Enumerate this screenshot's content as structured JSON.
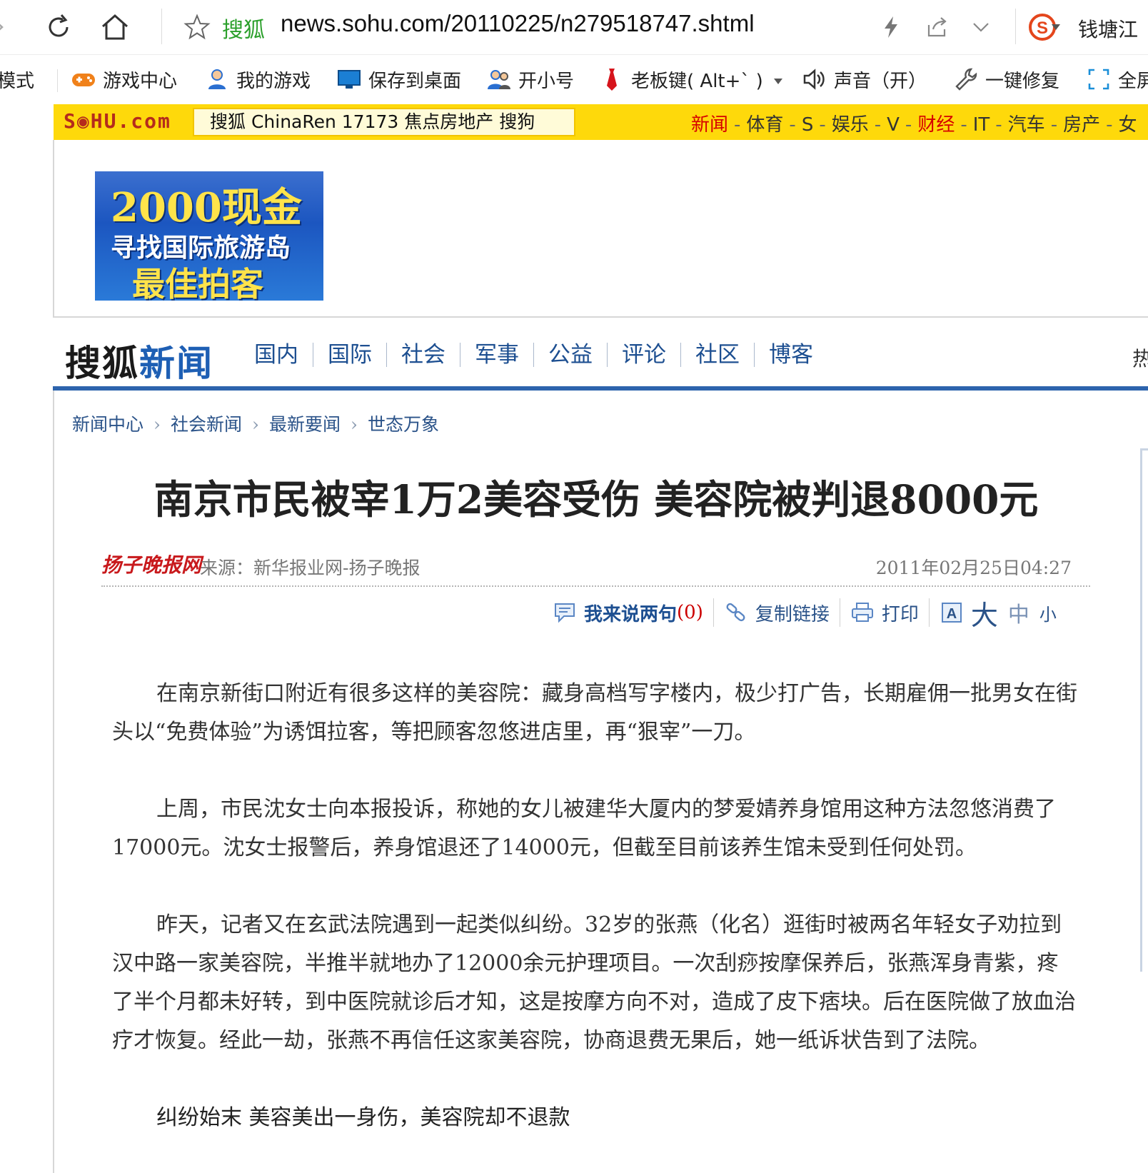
{
  "browser": {
    "site_name": "搜狐",
    "url": "news.sohu.com/20110225/n279518747.shtml",
    "right_label": "钱塘江"
  },
  "toolbar": {
    "mode_label": "模式",
    "items": [
      {
        "label": "游戏中心",
        "icon": "gamepad-icon"
      },
      {
        "label": "我的游戏",
        "icon": "user-icon"
      },
      {
        "label": "保存到桌面",
        "icon": "monitor-icon"
      },
      {
        "label": "开小号",
        "icon": "users-icon"
      },
      {
        "label": "老板键( Alt+` )",
        "icon": "tie-icon"
      },
      {
        "label": "声音（开）",
        "icon": "speaker-icon"
      },
      {
        "label": "一键修复",
        "icon": "wrench-icon"
      },
      {
        "label": "全屏",
        "icon": "fullscreen-icon"
      }
    ]
  },
  "sohu_strip": {
    "logo": "S◉HU.com",
    "portal_links": "搜狐 ChinaRen 17173 焦点房地产 搜狗",
    "channels": [
      {
        "label": "新闻",
        "red": true
      },
      {
        "label": "体育",
        "red": false
      },
      {
        "label": "S",
        "red": false
      },
      {
        "label": "娱乐",
        "red": false
      },
      {
        "label": "V",
        "red": false
      },
      {
        "label": "财经",
        "red": true
      },
      {
        "label": "IT",
        "red": false
      },
      {
        "label": "汽车",
        "red": false
      },
      {
        "label": "房产",
        "red": false
      },
      {
        "label": "女",
        "red": false
      }
    ]
  },
  "ad": {
    "line1": "2000现金",
    "line2": "寻找国际旅游岛",
    "line3": "最佳拍客"
  },
  "news_nav": {
    "logo_part1": "搜狐",
    "logo_part2": "新闻",
    "tabs": [
      "国内",
      "国际",
      "社会",
      "军事",
      "公益",
      "评论",
      "社区",
      "博客"
    ],
    "hot_label": "热"
  },
  "breadcrumb": [
    "新闻中心",
    "社会新闻",
    "最新要闻",
    "世态万象"
  ],
  "article": {
    "headline": "南京市民被宰1万2美容受伤  美容院被判退8000元",
    "source_logo": "扬子晚报网",
    "source": "来源：新华报业网-扬子晚报",
    "date": "2011年02月25日04:27",
    "tools": {
      "comment_label": "我来说两句",
      "comment_count": "(0)",
      "copy_link_label": "复制链接",
      "print_label": "打印",
      "size_large": "大",
      "size_medium": "中",
      "size_small": "小"
    },
    "paragraphs": [
      "在南京新街口附近有很多这样的美容院：藏身高档写字楼内，极少打广告，长期雇佣一批男女在街头以“免费体验”为诱饵拉客，等把顾客忽悠进店里，再“狠宰”一刀。",
      "上周，市民沈女士向本报投诉，称她的女儿被建华大厦内的梦爱婧养身馆用这种方法忽悠消费了17000元。沈女士报警后，养身馆退还了14000元，但截至目前该养生馆未受到任何处罚。",
      "昨天，记者又在玄武法院遇到一起类似纠纷。32岁的张燕（化名）逛街时被两名年轻女子劝拉到汉中路一家美容院，半推半就地办了12000余元护理项目。一次刮痧按摩保养后，张燕浑身青紫，疼了半个月都未好转，到中医院就诊后才知，这是按摩方向不对，造成了皮下痞块。后在医院做了放血治疗才恢复。经此一劫，张燕不再信任这家美容院，协商退费无果后，她一纸诉状告到了法院。"
    ],
    "subhead": "纠纷始末  美容美出一身伤，美容院却不退款"
  }
}
